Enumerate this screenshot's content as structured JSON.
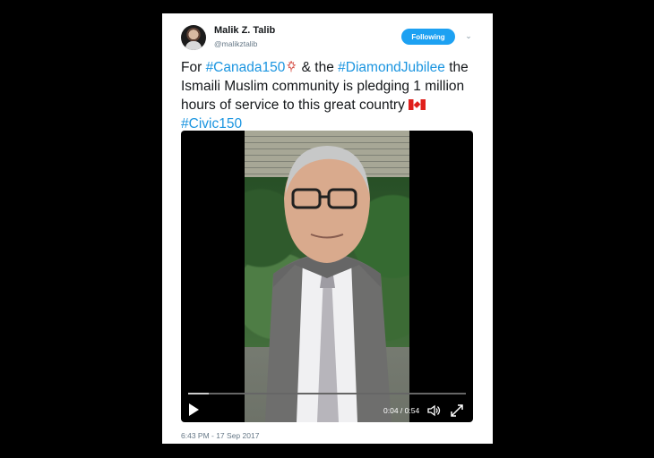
{
  "tweet": {
    "author_name": "Malik Z. Talib",
    "author_handle": "@malikztalib",
    "follow_label": "Following",
    "text_segments": {
      "part1": "For ",
      "tag1": "#Canada150",
      "part2": " & the ",
      "tag2": "#DiamondJubilee",
      "part3": " the Ismaili Muslim community is pledging 1 million hours of service to this great country ",
      "tag3": "#Civic150"
    },
    "timestamp": "6:43 PM - 17 Sep 2017"
  },
  "video": {
    "time_display": "0:04 / 0:54",
    "progress": 0.074
  },
  "icons": {
    "menu": "chevron-down-icon",
    "emoji1": "maple-leaf-icon",
    "emoji2": "canada-flag-icon",
    "play": "play-icon",
    "volume": "volume-icon",
    "fullscreen": "fullscreen-icon"
  },
  "colors": {
    "link": "#1b95e0",
    "follow_button": "#1da1f2"
  }
}
